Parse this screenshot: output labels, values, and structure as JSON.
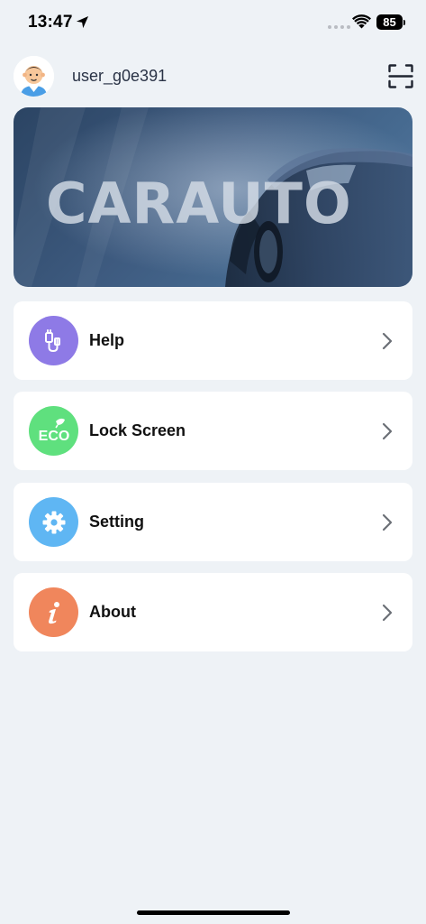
{
  "status_bar": {
    "time": "13:47",
    "battery": "85"
  },
  "header": {
    "username": "user_g0e391",
    "scan_icon": "scan-frame-icon"
  },
  "banner": {
    "brand_text": "CARAUTO"
  },
  "menu": {
    "items": [
      {
        "label": "Help",
        "icon": "usb-cable-icon",
        "color": "#8e7ae6"
      },
      {
        "label": "Lock Screen",
        "icon": "eco-leaf-icon",
        "color": "#5fe07e"
      },
      {
        "label": "Setting",
        "icon": "gear-icon",
        "color": "#5fb6f3"
      },
      {
        "label": "About",
        "icon": "info-icon",
        "color": "#f0865c"
      }
    ]
  }
}
